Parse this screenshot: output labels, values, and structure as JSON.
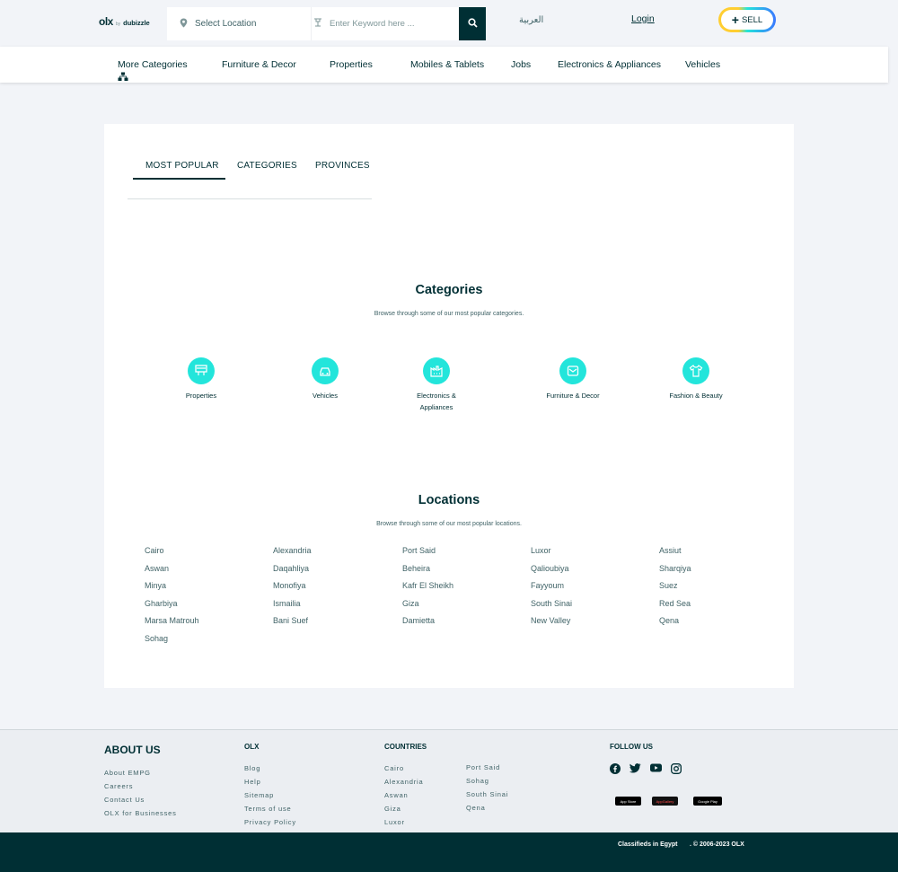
{
  "header": {
    "logo_main": "olx",
    "logo_by": "by",
    "logo_brand": "dubizzle",
    "location_placeholder": "Select Location",
    "keyword_placeholder": "Enter Keyword here ...",
    "language_link": "العربية",
    "login_label": "Login",
    "sell_label": "SELL"
  },
  "nav": {
    "items": [
      "More Categories",
      "Furniture & Decor",
      "Properties",
      "Mobiles & Tablets",
      "Jobs",
      "Electronics & Appliances",
      "Vehicles"
    ]
  },
  "tabs": [
    "MOST POPULAR",
    "CATEGORIES",
    "PROVINCES"
  ],
  "categories_section": {
    "title": "Categories",
    "subtitle": "Browse through some of our most popular categories.",
    "items": [
      {
        "label": "Properties",
        "icon": "property-sign-icon"
      },
      {
        "label": "Vehicles",
        "icon": "car-icon"
      },
      {
        "label": "Electronics & Appliances",
        "icon": "factory-icon"
      },
      {
        "label": "Furniture & Decor",
        "icon": "sofa-icon"
      },
      {
        "label": "Fashion & Beauty",
        "icon": "shirt-icon"
      }
    ]
  },
  "locations_section": {
    "title": "Locations",
    "subtitle": "Browse through some of our most popular locations.",
    "columns": [
      [
        "Cairo",
        "Aswan",
        "Minya",
        "Gharbiya",
        "Marsa Matrouh",
        "Sohag"
      ],
      [
        "Alexandria",
        "Daqahliya",
        "Monofiya",
        "Ismailia",
        "Bani Suef"
      ],
      [
        "Port Said",
        "Beheira",
        "Kafr El Sheikh",
        "Giza",
        "Damietta"
      ],
      [
        "Luxor",
        "Qalioubiya",
        "Fayyoum",
        "South Sinai",
        "New Valley"
      ],
      [
        "Assiut",
        "Sharqiya",
        "Suez",
        "Red Sea",
        "Qena"
      ]
    ]
  },
  "footer": {
    "about": {
      "title": "ABOUT US",
      "links": [
        "About EMPG",
        "Careers",
        "Contact Us",
        "OLX for Businesses"
      ]
    },
    "olx": {
      "title": "OLX",
      "links": [
        "Blog",
        "Help",
        "Sitemap",
        "Terms of use",
        "Privacy Policy"
      ]
    },
    "countries": {
      "title": "COUNTRIES",
      "col1": [
        "Cairo",
        "Alexandria",
        "Aswan",
        "Giza",
        "Luxor"
      ],
      "col2": [
        "Port Said",
        "Sohag",
        "South Sinai",
        "Qena"
      ]
    },
    "follow": {
      "title": "FOLLOW US",
      "icons": [
        "facebook-icon",
        "twitter-icon",
        "youtube-icon",
        "instagram-icon"
      ]
    },
    "stores": [
      "App Store",
      "AppGallery",
      "Google Play"
    ]
  },
  "bottom": {
    "left_text": "Classifieds in Egypt",
    "right_text": ". © 2006-2023 OLX"
  },
  "colors": {
    "primary": "#002f34",
    "accent": "#23e5db",
    "sell_yellow": "#ffce32",
    "sell_blue": "#3a77ff"
  }
}
